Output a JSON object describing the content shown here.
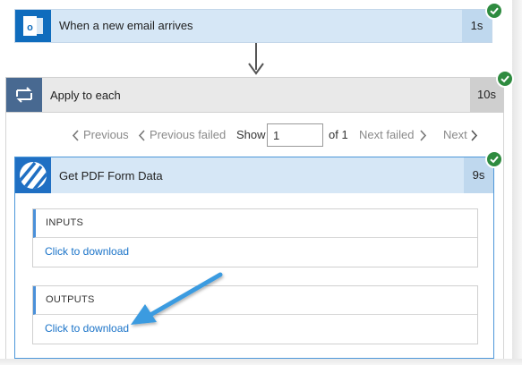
{
  "flow": {
    "trigger": {
      "title": "When a new email arrives",
      "duration": "1s",
      "icon": "outlook-icon"
    },
    "loop": {
      "title": "Apply to each",
      "duration": "10s",
      "icon": "loop-icon"
    },
    "pager": {
      "previous": "Previous",
      "previous_failed": "Previous failed",
      "show": "Show",
      "page_value": "1",
      "of": "of 1",
      "next_failed": "Next failed",
      "next": "Next"
    },
    "action": {
      "title": "Get PDF Form Data",
      "duration": "9s",
      "icon": "pdf-form-icon",
      "inputs": {
        "header": "INPUTS",
        "link": "Click to download"
      },
      "outputs": {
        "header": "OUTPUTS",
        "link": "Click to download"
      }
    }
  },
  "colors": {
    "step_header": "#d6e7f6",
    "outlook_blue": "#0f6cbd",
    "loop_icon_bg": "#486991",
    "success_green": "#2e8b3f",
    "link_blue": "#1a73c8",
    "annotation_arrow": "#3a9be0"
  }
}
